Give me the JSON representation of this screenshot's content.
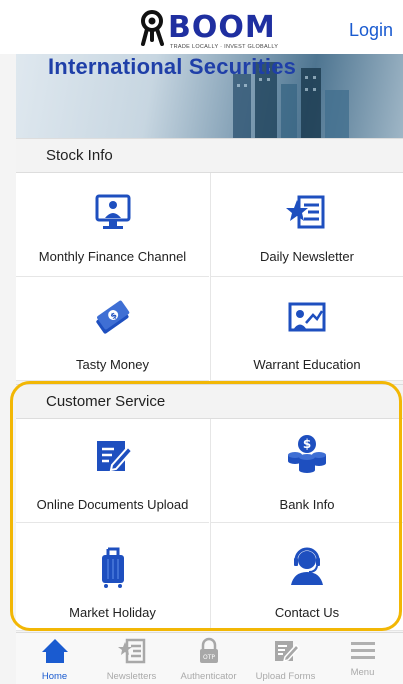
{
  "header": {
    "logo_text": "BOOM",
    "logo_tagline": "TRADE LOCALLY · INVEST GLOBALLY",
    "login_label": "Login"
  },
  "banner": {
    "title": "International Securities"
  },
  "stock_info": {
    "title": "Stock Info",
    "items": [
      {
        "label": "Monthly Finance Channel",
        "icon": "monitor-presenter-icon"
      },
      {
        "label": "Daily Newsletter",
        "icon": "newsletter-star-icon"
      },
      {
        "label": "Tasty Money",
        "icon": "money-hand-icon"
      },
      {
        "label": "Warrant Education",
        "icon": "teacher-board-icon"
      }
    ]
  },
  "customer_service": {
    "title": "Customer Service",
    "items": [
      {
        "label": "Online Documents Upload",
        "icon": "pencil-document-icon"
      },
      {
        "label": "Bank Info",
        "icon": "coins-dollar-icon"
      },
      {
        "label": "Market Holiday",
        "icon": "luggage-icon"
      },
      {
        "label": "Contact Us",
        "icon": "headset-agent-icon"
      }
    ]
  },
  "tabbar": {
    "tabs": [
      {
        "label": "Home",
        "icon": "home-icon",
        "active": true
      },
      {
        "label": "Newsletters",
        "icon": "newsletter-icon",
        "active": false
      },
      {
        "label": "Authenticator",
        "icon": "otp-lock-icon",
        "active": false
      },
      {
        "label": "Upload Forms",
        "icon": "pencil-document-icon",
        "active": false
      },
      {
        "label": "Menu",
        "icon": "menu-icon",
        "active": false
      }
    ]
  },
  "colors": {
    "brand_blue": "#1f2fa0",
    "icon_blue": "#1e4fbf",
    "link_blue": "#1a5bd0",
    "highlight": "#f2b705"
  }
}
